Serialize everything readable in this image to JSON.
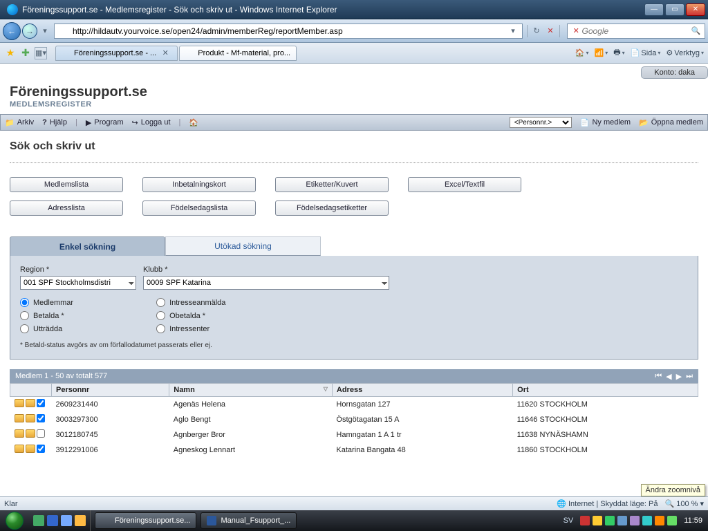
{
  "window": {
    "title": "Föreningssupport.se - Medlemsregister - Sök och skriv ut - Windows Internet Explorer"
  },
  "address": {
    "url": "http://hildautv.yourvoice.se/open24/admin/memberReg/reportMember.asp"
  },
  "search_engine": {
    "placeholder": "Google"
  },
  "tabs": [
    {
      "label": "Föreningssupport.se - ...",
      "active": true
    },
    {
      "label": "Produkt - Mf-material, pro...",
      "active": false
    }
  ],
  "tools": {
    "page": "Sida",
    "verktyg": "Verktyg"
  },
  "account": {
    "label": "Konto: daka"
  },
  "brand": {
    "title": "Föreningssupport.se",
    "sub": "MEDLEMSREGISTER"
  },
  "menubar": {
    "arkiv": "Arkiv",
    "help": "Hjälp",
    "program": "Program",
    "logout": "Logga ut",
    "search_sel": "<Personnr.>",
    "new_member": "Ny medlem",
    "open_member": "Öppna medlem"
  },
  "page_title": "Sök och skriv ut",
  "buttons": {
    "medlemslista": "Medlemslista",
    "inbetalningskort": "Inbetalningskort",
    "etiketter": "Etiketter/Kuvert",
    "excel": "Excel/Textfil",
    "adresslista": "Adresslista",
    "fodelsedagslista": "Födelsedagslista",
    "fodelsedagsetiketter": "Födelsedagsetiketter"
  },
  "search_tabs": {
    "enkel": "Enkel sökning",
    "utokad": "Utökad sökning"
  },
  "form": {
    "region_label": "Region *",
    "region_value": "001 SPF Stockholmsdistri",
    "klubb_label": "Klubb *",
    "klubb_value": "0009 SPF Katarina",
    "radios": {
      "medlemmar": "Medlemmar",
      "betalda": "Betalda *",
      "uttradda": "Utträdda",
      "intresseanmalda": "Intresseanmälda",
      "obetalda": "Obetalda *",
      "intressenter": "Intressenter"
    },
    "note": "* Betald-status avgörs av om förfallodatumet passerats eller ej."
  },
  "results": {
    "summary": "Medlem 1 - 50 av totalt 577",
    "cols": {
      "personnr": "Personnr",
      "namn": "Namn",
      "adress": "Adress",
      "ort": "Ort"
    },
    "rows": [
      {
        "checked": true,
        "personnr": "2609231440",
        "namn": "Agenäs Helena",
        "adress": "Hornsgatan 127",
        "ort": "11620 STOCKHOLM"
      },
      {
        "checked": true,
        "personnr": "3003297300",
        "namn": "Aglo Bengt",
        "adress": "Östgötagatan 15 A",
        "ort": "11646 STOCKHOLM"
      },
      {
        "checked": false,
        "personnr": "3012180745",
        "namn": "Agnberger Bror",
        "adress": "Hamngatan 1 A 1 tr",
        "ort": "11638 NYNÄSHAMN"
      },
      {
        "checked": true,
        "personnr": "3912291006",
        "namn": "Agneskog Lennart",
        "adress": "Katarina Bangata 48",
        "ort": "11860 STOCKHOLM"
      }
    ]
  },
  "status": {
    "left": "Klar",
    "security": "Internet | Skyddat läge: På",
    "zoom": "100 %",
    "zoom_tip": "Ändra zoomnivå"
  },
  "taskbar": {
    "ie": "Föreningssupport.se...",
    "word": "Manual_Fsupport_...",
    "lang": "SV",
    "time": "11:59"
  }
}
